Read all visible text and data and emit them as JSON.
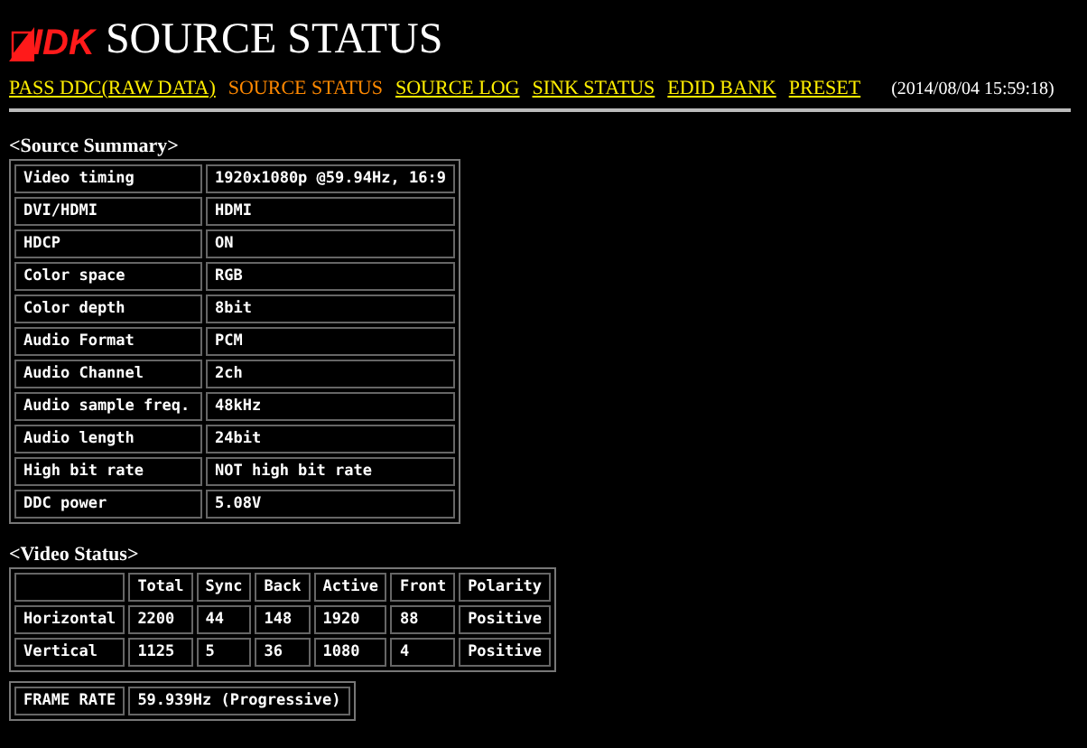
{
  "header": {
    "logo": "IDK",
    "title": "SOURCE STATUS"
  },
  "nav": [
    {
      "label": "PASS DDC(RAW DATA)",
      "selected": false
    },
    {
      "label": "SOURCE STATUS",
      "selected": true
    },
    {
      "label": "SOURCE LOG",
      "selected": false
    },
    {
      "label": "SINK STATUS",
      "selected": false
    },
    {
      "label": "EDID BANK",
      "selected": false
    },
    {
      "label": "PRESET",
      "selected": false
    }
  ],
  "timestamp": "(2014/08/04 15:59:18)",
  "source_summary": {
    "heading": "<Source Summary>",
    "rows": [
      [
        "Video timing",
        "1920x1080p @59.94Hz, 16:9"
      ],
      [
        "DVI/HDMI",
        "HDMI"
      ],
      [
        "HDCP",
        "ON"
      ],
      [
        "Color space",
        "RGB"
      ],
      [
        "Color depth",
        "8bit"
      ],
      [
        "Audio Format",
        "PCM"
      ],
      [
        "Audio Channel",
        "2ch"
      ],
      [
        "Audio sample freq.",
        "48kHz"
      ],
      [
        "Audio length",
        "24bit"
      ],
      [
        "High bit rate",
        "NOT high bit rate"
      ],
      [
        "DDC power",
        "5.08V"
      ]
    ]
  },
  "video_status": {
    "heading": "<Video Status>",
    "columns": [
      "",
      "Total",
      "Sync",
      "Back",
      "Active",
      "Front",
      "Polarity"
    ],
    "rows": [
      [
        "Horizontal",
        "2200",
        "44",
        "148",
        "1920",
        "88",
        "Positive"
      ],
      [
        "Vertical",
        "1125",
        "5",
        "36",
        "1080",
        "4",
        "Positive"
      ]
    ]
  },
  "frame_rate": [
    "FRAME RATE",
    "59.939Hz (Progressive)"
  ]
}
